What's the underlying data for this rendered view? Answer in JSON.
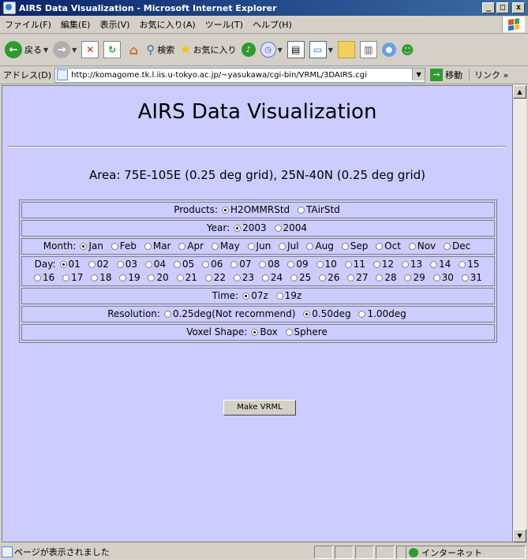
{
  "window": {
    "title": "AIRS Data Visualization - Microsoft Internet Explorer",
    "buttons": [
      "_",
      "□",
      "x"
    ]
  },
  "menu": [
    "ファイル(F)",
    "編集(E)",
    "表示(V)",
    "お気に入り(A)",
    "ツール(T)",
    "ヘルプ(H)"
  ],
  "toolbar": {
    "back": "戻る",
    "search": "検索",
    "favorites": "お気に入り"
  },
  "address": {
    "label": "アドレス(D)",
    "url": "http://komagome.tk.l.iis.u-tokyo.ac.jp/~yasukawa/cgi-bin/VRML/3DAIRS.cgi",
    "go": "移動",
    "links": "リンク »"
  },
  "page": {
    "title": "AIRS Data Visualization",
    "area": "Area: 75E-105E (0.25 deg grid), 25N-40N (0.25 deg grid)",
    "products": {
      "label": "Products:",
      "options": [
        "H2OMMRStd",
        "TAirStd"
      ],
      "selected": 0
    },
    "year": {
      "label": "Year:",
      "options": [
        "2003",
        "2004"
      ],
      "selected": 0
    },
    "month": {
      "label": "Month:",
      "options": [
        "Jan",
        "Feb",
        "Mar",
        "Apr",
        "May",
        "Jun",
        "Jul",
        "Aug",
        "Sep",
        "Oct",
        "Nov",
        "Dec"
      ],
      "selected": 0
    },
    "day": {
      "label": "Day:",
      "options": [
        "01",
        "02",
        "03",
        "04",
        "05",
        "06",
        "07",
        "08",
        "09",
        "10",
        "11",
        "12",
        "13",
        "14",
        "15",
        "16",
        "17",
        "18",
        "19",
        "20",
        "21",
        "22",
        "23",
        "24",
        "25",
        "26",
        "27",
        "28",
        "29",
        "30",
        "31"
      ],
      "selected": 0
    },
    "time": {
      "label": "Time:",
      "options": [
        "07z",
        "19z"
      ],
      "selected": 0
    },
    "resolution": {
      "label": "Resolution:",
      "options": [
        "0.25deg(Not recommend)",
        "0.50deg",
        "1.00deg"
      ],
      "selected": 1
    },
    "voxel": {
      "label": "Voxel Shape:",
      "options": [
        "Box",
        "Sphere"
      ],
      "selected": 0
    },
    "submit": "Make VRML"
  },
  "status": {
    "text": "ページが表示されました",
    "zone": "インターネット"
  }
}
